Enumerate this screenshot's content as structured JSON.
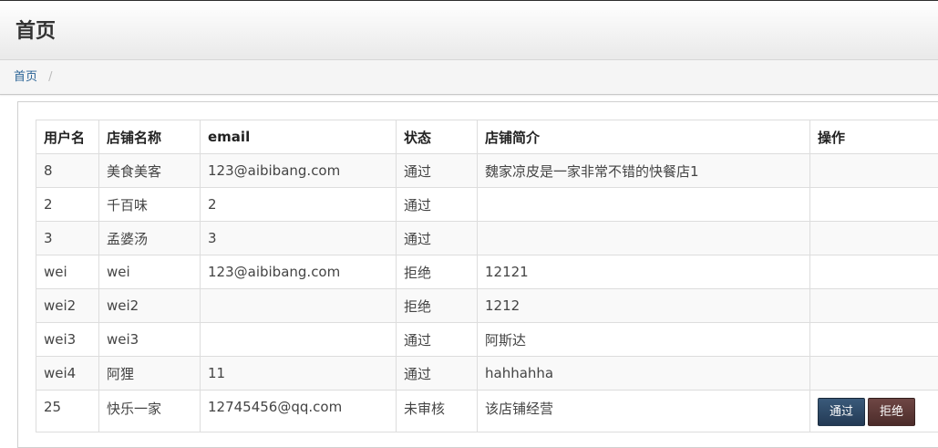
{
  "header": {
    "title": "首页"
  },
  "breadcrumb": {
    "items": [
      "首页"
    ],
    "separator": "/"
  },
  "table": {
    "columns": [
      "用户名",
      "店铺名称",
      "email",
      "状态",
      "店铺简介",
      "操作"
    ],
    "rows": [
      {
        "username": "8",
        "shop_name": "美食美客",
        "email": "123@aibibang.com",
        "status": "通过",
        "description": "魏家凉皮是一家非常不错的快餐店1"
      },
      {
        "username": "2",
        "shop_name": "千百味",
        "email": "2",
        "status": "通过",
        "description": ""
      },
      {
        "username": "3",
        "shop_name": "孟婆汤",
        "email": "3",
        "status": "通过",
        "description": ""
      },
      {
        "username": "wei",
        "shop_name": "wei",
        "email": "123@aibibang.com",
        "status": "拒绝",
        "description": "12121"
      },
      {
        "username": "wei2",
        "shop_name": "wei2",
        "email": "",
        "status": "拒绝",
        "description": "1212"
      },
      {
        "username": "wei3",
        "shop_name": "wei3",
        "email": "",
        "status": "通过",
        "description": "阿斯达"
      },
      {
        "username": "wei4",
        "shop_name": "阿狸",
        "email": "11",
        "status": "通过",
        "description": "hahhahha"
      },
      {
        "username": "25",
        "shop_name": "快乐一家",
        "email": "12745456@qq.com",
        "status": "未审核",
        "description": "该店铺经营",
        "actions": {
          "approve": "通过",
          "reject": "拒绝"
        }
      }
    ]
  },
  "colors": {
    "approve_button": "#2b4868",
    "reject_button": "#5c3836",
    "breadcrumb_link": "#2a6496"
  }
}
